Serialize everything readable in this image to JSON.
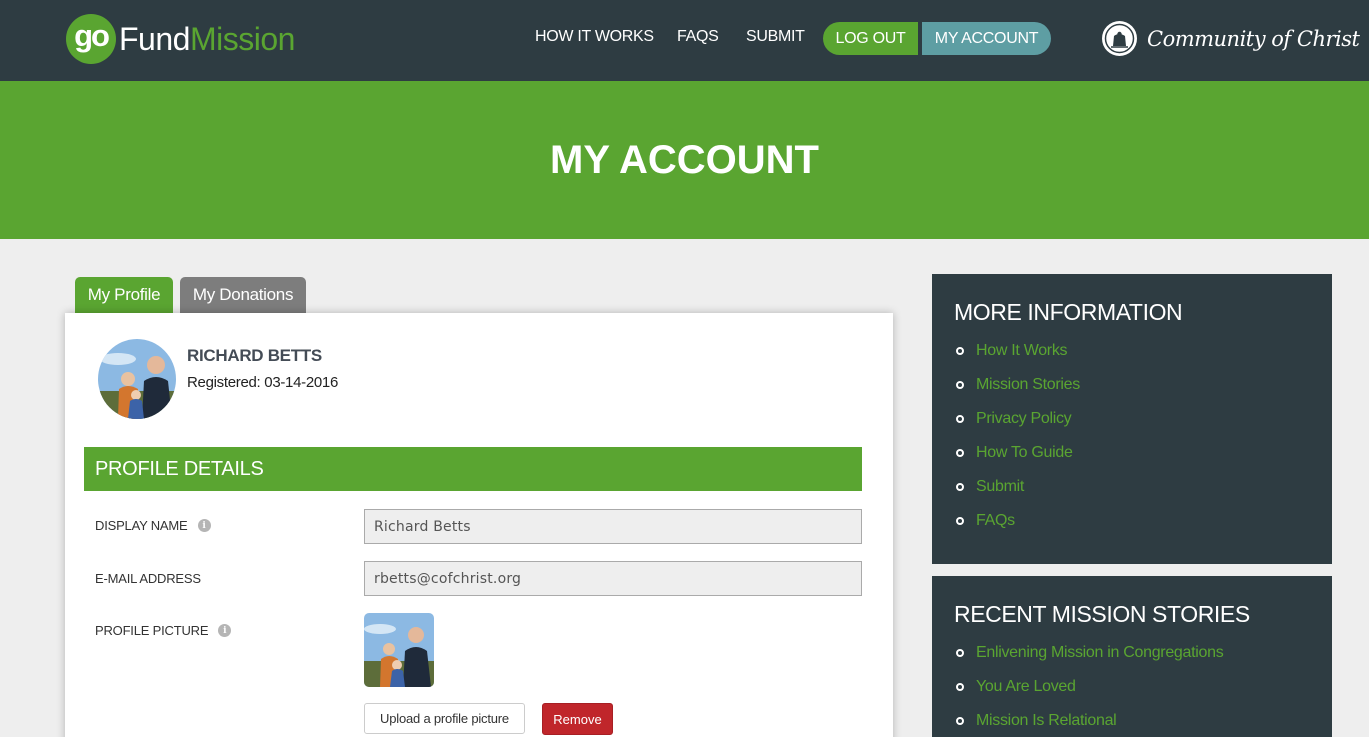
{
  "brand": {
    "go": "go",
    "fund": "Fund",
    "mission": "Mission"
  },
  "nav": {
    "how_it_works": "HOW IT WORKS",
    "faqs": "FAQS",
    "submit": "SUBMIT",
    "logout": "LOG OUT",
    "my_account": "MY ACCOUNT"
  },
  "partner": {
    "name": "Community of Christ"
  },
  "hero": {
    "title": "MY ACCOUNT"
  },
  "tabs": [
    {
      "label": "My Profile",
      "active": true
    },
    {
      "label": "My Donations",
      "active": false
    }
  ],
  "profile": {
    "name": "RICHARD BETTS",
    "registered": "Registered: 03-14-2016",
    "section_title": "PROFILE DETAILS",
    "fields": {
      "display_name": {
        "label": "DISPLAY NAME",
        "value": "Richard Betts"
      },
      "email": {
        "label": "E-MAIL ADDRESS",
        "value": "rbetts@cofchrist.org"
      },
      "picture": {
        "label": "PROFILE PICTURE"
      }
    },
    "upload_label": "Upload a profile picture",
    "remove_label": "Remove"
  },
  "more_info": {
    "title": "MORE INFORMATION",
    "links": [
      "How It Works",
      "Mission Stories",
      "Privacy Policy",
      "How To Guide",
      "Submit",
      "FAQs"
    ]
  },
  "recent_stories": {
    "title": "RECENT MISSION STORIES",
    "links": [
      "Enlivening Mission in Congregations",
      "You Are Loved",
      "Mission Is Relational"
    ]
  },
  "colors": {
    "accent_green": "#5aa531",
    "nav_dark": "#2e3c42",
    "account_teal": "#5e9ea3",
    "remove_red": "#c0262b"
  },
  "icons": {
    "info": "info-icon",
    "bullet": "bullet-icon",
    "seal": "seal-icon",
    "avatar": "avatar-photo"
  }
}
